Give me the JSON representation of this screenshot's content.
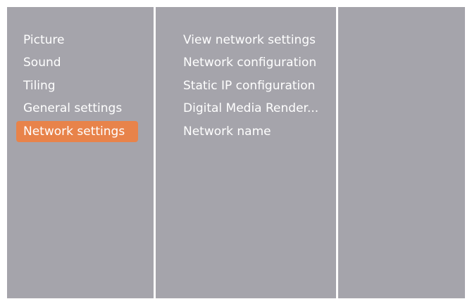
{
  "main_menu": {
    "items": [
      {
        "label": "Picture",
        "selected": false
      },
      {
        "label": "Sound",
        "selected": false
      },
      {
        "label": "Tiling",
        "selected": false
      },
      {
        "label": "General settings",
        "selected": false
      },
      {
        "label": "Network settings",
        "selected": true
      }
    ]
  },
  "sub_menu": {
    "items": [
      {
        "label": "View network settings"
      },
      {
        "label": "Network configuration"
      },
      {
        "label": "Static IP configuration"
      },
      {
        "label": "Digital Media Render..."
      },
      {
        "label": "Network name"
      }
    ]
  },
  "colors": {
    "panel_background": "#a5a4ab",
    "divider": "#ffffff",
    "selection_highlight": "#e8834a",
    "text": "#ffffff"
  }
}
